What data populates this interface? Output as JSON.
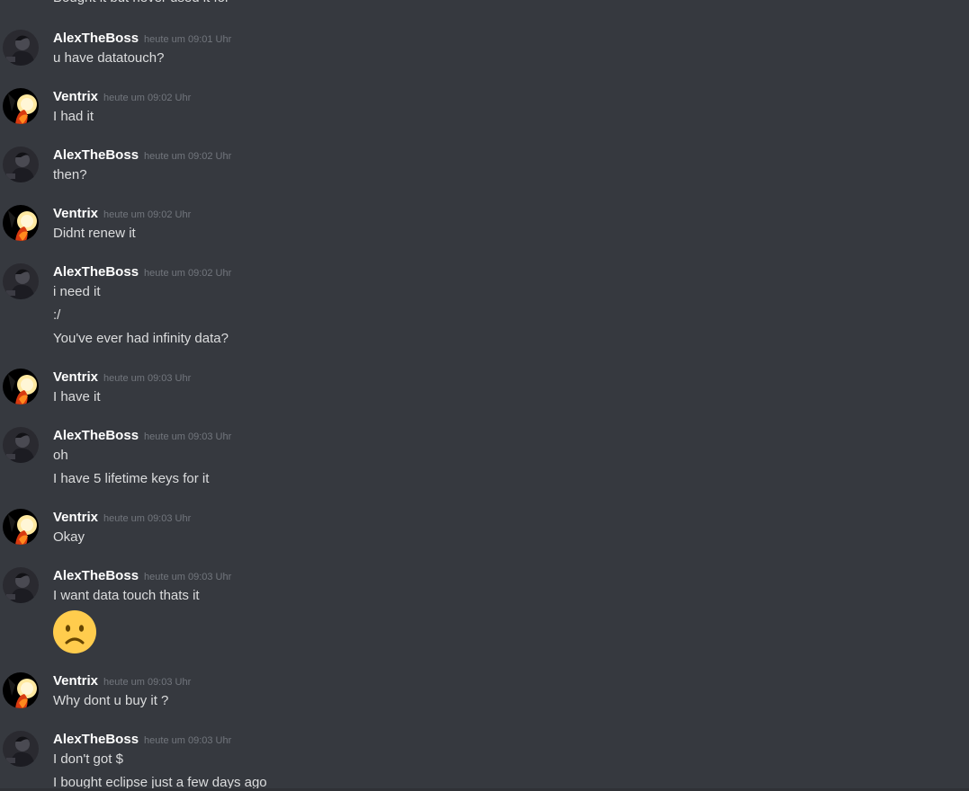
{
  "partial_top_line": "Bought it but never used it for",
  "messages": [
    {
      "author": "AlexTheBoss",
      "time": "heute um 09:01 Uhr",
      "lines": [
        "u have datatouch?"
      ]
    },
    {
      "author": "Ventrix",
      "time": "heute um 09:02 Uhr",
      "lines": [
        "I had it"
      ]
    },
    {
      "author": "AlexTheBoss",
      "time": "heute um 09:02 Uhr",
      "lines": [
        "then?"
      ]
    },
    {
      "author": "Ventrix",
      "time": "heute um 09:02 Uhr",
      "lines": [
        "Didnt renew it"
      ]
    },
    {
      "author": "AlexTheBoss",
      "time": "heute um 09:02 Uhr",
      "lines": [
        "i need it",
        ":/",
        "You've ever had infinity data?"
      ]
    },
    {
      "author": "Ventrix",
      "time": "heute um 09:03 Uhr",
      "lines": [
        "I have it"
      ]
    },
    {
      "author": "AlexTheBoss",
      "time": "heute um 09:03 Uhr",
      "lines": [
        "oh",
        "I have 5 lifetime keys for it"
      ]
    },
    {
      "author": "Ventrix",
      "time": "heute um 09:03 Uhr",
      "lines": [
        "Okay"
      ]
    },
    {
      "author": "AlexTheBoss",
      "time": "heute um 09:03 Uhr",
      "lines": [
        "I want data touch thats it"
      ],
      "emoji": "frowning-face"
    },
    {
      "author": "Ventrix",
      "time": "heute um 09:03 Uhr",
      "lines": [
        "Why dont u buy it ?"
      ]
    },
    {
      "author": "AlexTheBoss",
      "time": "heute um 09:03 Uhr",
      "lines": [
        "I don't got $",
        "I bought eclipse just a few days ago"
      ]
    }
  ],
  "colors": {
    "background": "#36393f",
    "username": "#ffffff",
    "timestamp": "#72767d",
    "text": "#dcddde"
  }
}
